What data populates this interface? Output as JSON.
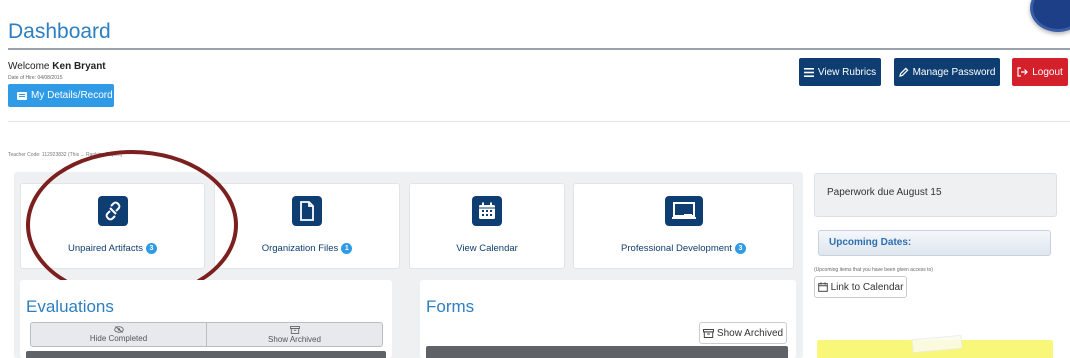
{
  "header": {
    "title": "Dashboard"
  },
  "user": {
    "welcome_prefix": "Welcome",
    "name": "Ken Bryant",
    "hire_date": "Date of Hire: 04/08/2015",
    "details_button": "My Details/Record"
  },
  "toolbar": {
    "rubrics_label": "View Rubrics",
    "password_label": "Manage Password",
    "logout_label": "Logout"
  },
  "teacher_code": "Teacher Code: 112923832 (This ... Ranking Report)",
  "cards": [
    {
      "label": "Unpaired Artifacts",
      "badge": "3",
      "icon": "unlink-icon"
    },
    {
      "label": "Organization Files",
      "badge": "1",
      "icon": "file-icon"
    },
    {
      "label": "View Calendar",
      "badge": "",
      "icon": "calendar-icon"
    },
    {
      "label": "Professional Development",
      "badge": "3",
      "icon": "laptop-icon"
    }
  ],
  "evaluations": {
    "title": "Evaluations",
    "hide_completed": "Hide Completed",
    "show_archived": "Show Archived"
  },
  "forms": {
    "title": "Forms",
    "show_archived": "Show Archived"
  },
  "sidebar": {
    "paperwork": "Paperwork due August 15",
    "upcoming_title": "Upcoming Dates:",
    "upcoming_note": "(Upcoming items that you have been given access to)",
    "link_calendar": "Link to Calendar"
  },
  "colors": {
    "primary": "#0e3d72",
    "accent": "#2f9ae6",
    "danger": "#d4202a",
    "title": "#2d7fc1"
  }
}
